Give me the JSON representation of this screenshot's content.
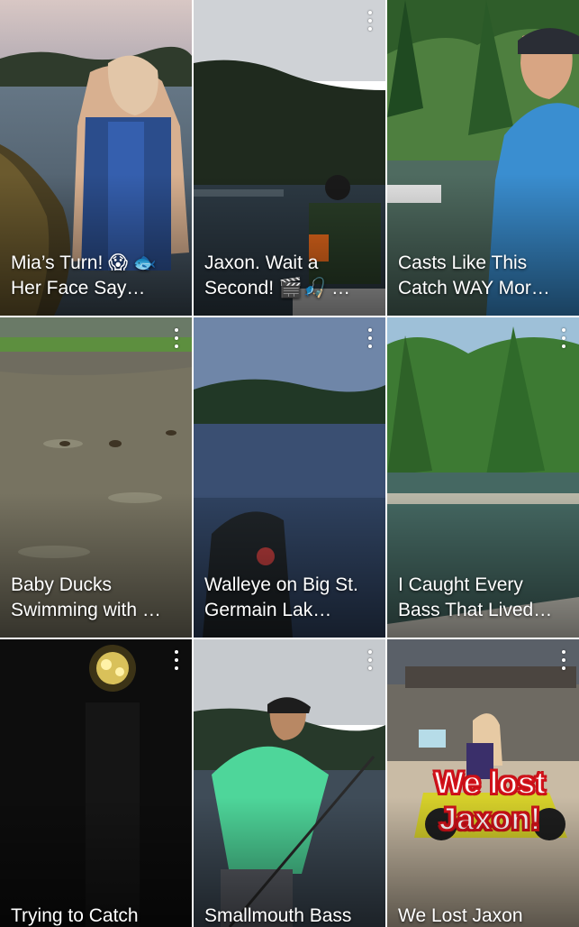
{
  "videos": [
    {
      "title": "Mia’s Turn! 😱 🐟 Her Face Say…"
    },
    {
      "title": "Jaxon. Wait a Second! 🎬🎣 …"
    },
    {
      "title": "Casts Like This Catch WAY Mor…"
    },
    {
      "title": "Baby Ducks Swimming with …"
    },
    {
      "title": "Walleye on Big St. Germain Lak…"
    },
    {
      "title": "I Caught Every Bass That Lived…"
    },
    {
      "title": "Trying to Catch"
    },
    {
      "title": "Smallmouth Bass"
    },
    {
      "title": "We Lost Jaxon",
      "thumbnail_text": "We lost Jaxon!"
    }
  ],
  "menu_icon": "more-vert-icon",
  "colors": {
    "overlay_text_stroke": "#d3131b",
    "background": "#ffffff"
  }
}
